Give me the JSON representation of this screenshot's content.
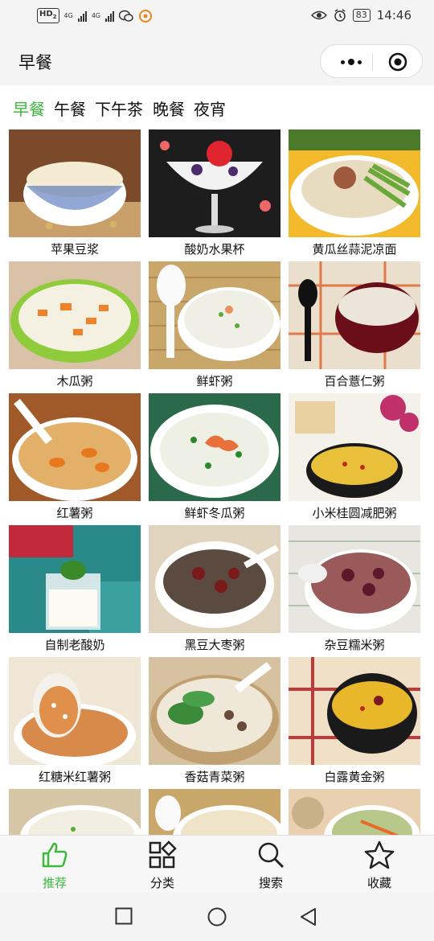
{
  "status_bar": {
    "network_badge": "HD",
    "network_badge_sub": "2",
    "signal1_label": "4G",
    "signal2_label": "4G",
    "battery": "83",
    "time": "14:46"
  },
  "header": {
    "title": "早餐"
  },
  "tabs": [
    {
      "label": "早餐",
      "active": true
    },
    {
      "label": "午餐",
      "active": false
    },
    {
      "label": "下午茶",
      "active": false
    },
    {
      "label": "晚餐",
      "active": false
    },
    {
      "label": "夜宵",
      "active": false
    }
  ],
  "recipes": [
    {
      "name": "苹果豆浆"
    },
    {
      "name": "酸奶水果杯"
    },
    {
      "name": "黄瓜丝蒜泥凉面"
    },
    {
      "name": "木瓜粥"
    },
    {
      "name": "鲜虾粥"
    },
    {
      "name": "百合薏仁粥"
    },
    {
      "name": "红薯粥"
    },
    {
      "name": "鲜虾冬瓜粥"
    },
    {
      "name": "小米桂圆减肥粥"
    },
    {
      "name": "自制老酸奶"
    },
    {
      "name": "黑豆大枣粥"
    },
    {
      "name": "杂豆糯米粥"
    },
    {
      "name": "红糖米红薯粥"
    },
    {
      "name": "香菇青菜粥"
    },
    {
      "name": "白露黄金粥"
    }
  ],
  "tabbar": [
    {
      "label": "推荐",
      "icon": "thumbs-up-icon",
      "active": true
    },
    {
      "label": "分类",
      "icon": "category-grid-icon",
      "active": false
    },
    {
      "label": "搜索",
      "icon": "search-icon",
      "active": false
    },
    {
      "label": "收藏",
      "icon": "star-icon",
      "active": false
    }
  ],
  "colors": {
    "accent": "#3cb93c"
  }
}
